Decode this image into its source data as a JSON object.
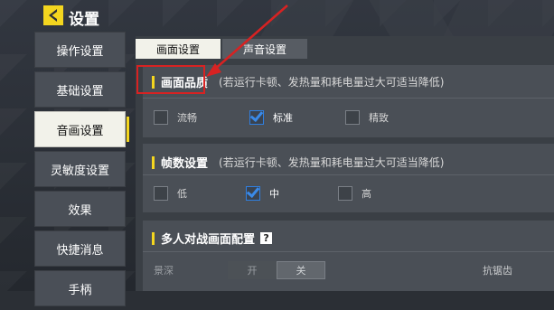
{
  "header": {
    "title": "设置"
  },
  "sidebar": {
    "items": [
      {
        "label": "操作设置",
        "active": false
      },
      {
        "label": "基础设置",
        "active": false
      },
      {
        "label": "音画设置",
        "active": true
      },
      {
        "label": "灵敏度设置",
        "active": false
      },
      {
        "label": "效果",
        "active": false
      },
      {
        "label": "快捷消息",
        "active": false
      },
      {
        "label": "手柄",
        "active": false
      }
    ]
  },
  "tabs": [
    {
      "label": "画面设置",
      "active": true
    },
    {
      "label": "声音设置",
      "active": false
    }
  ],
  "quality": {
    "title": "画面品质",
    "note": "(若运行卡顿、发热量和耗电量过大可适当降低)",
    "options": [
      {
        "label": "流畅",
        "checked": false
      },
      {
        "label": "标准",
        "checked": true
      },
      {
        "label": "精致",
        "checked": false
      }
    ]
  },
  "framerate": {
    "title": "帧数设置",
    "note": "(若运行卡顿、发热量和耗电量过大可适当降低)",
    "options": [
      {
        "label": "低",
        "checked": false
      },
      {
        "label": "中",
        "checked": true
      },
      {
        "label": "高",
        "checked": false
      }
    ]
  },
  "multiplayer": {
    "title": "多人对战画面配置",
    "help": "?",
    "depth_label": "景深",
    "toggle_on": "开",
    "toggle_off": "关",
    "toggle_value": "关",
    "antialias_label": "抗锯齿"
  },
  "colors": {
    "accent": "#f4d61f",
    "check": "#3a8ae8",
    "annotation": "#d82222"
  }
}
